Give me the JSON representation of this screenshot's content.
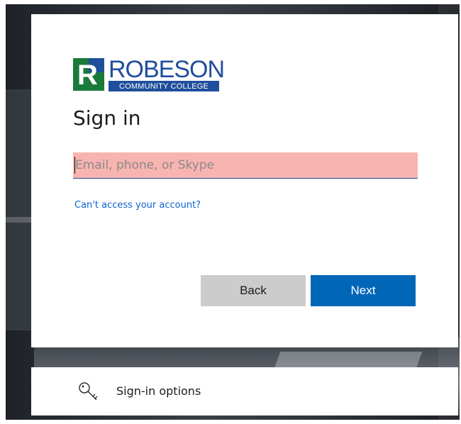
{
  "brand": {
    "logo_letter": "R",
    "name": "ROBESON",
    "subname": "COMMUNITY COLLEGE"
  },
  "signin": {
    "title": "Sign in",
    "input_placeholder": "Email, phone, or Skype",
    "input_value": "",
    "help_link": "Can't access your account?",
    "back_label": "Back",
    "next_label": "Next"
  },
  "options": {
    "label": "Sign-in options",
    "icon": "key-icon"
  },
  "colors": {
    "brand_blue": "#1f4e9c",
    "brand_green": "#1a7a3a",
    "next_button": "#0067b8",
    "back_button": "#cccccc",
    "link": "#0b63ce",
    "input_highlight": "#f8b4b0"
  }
}
